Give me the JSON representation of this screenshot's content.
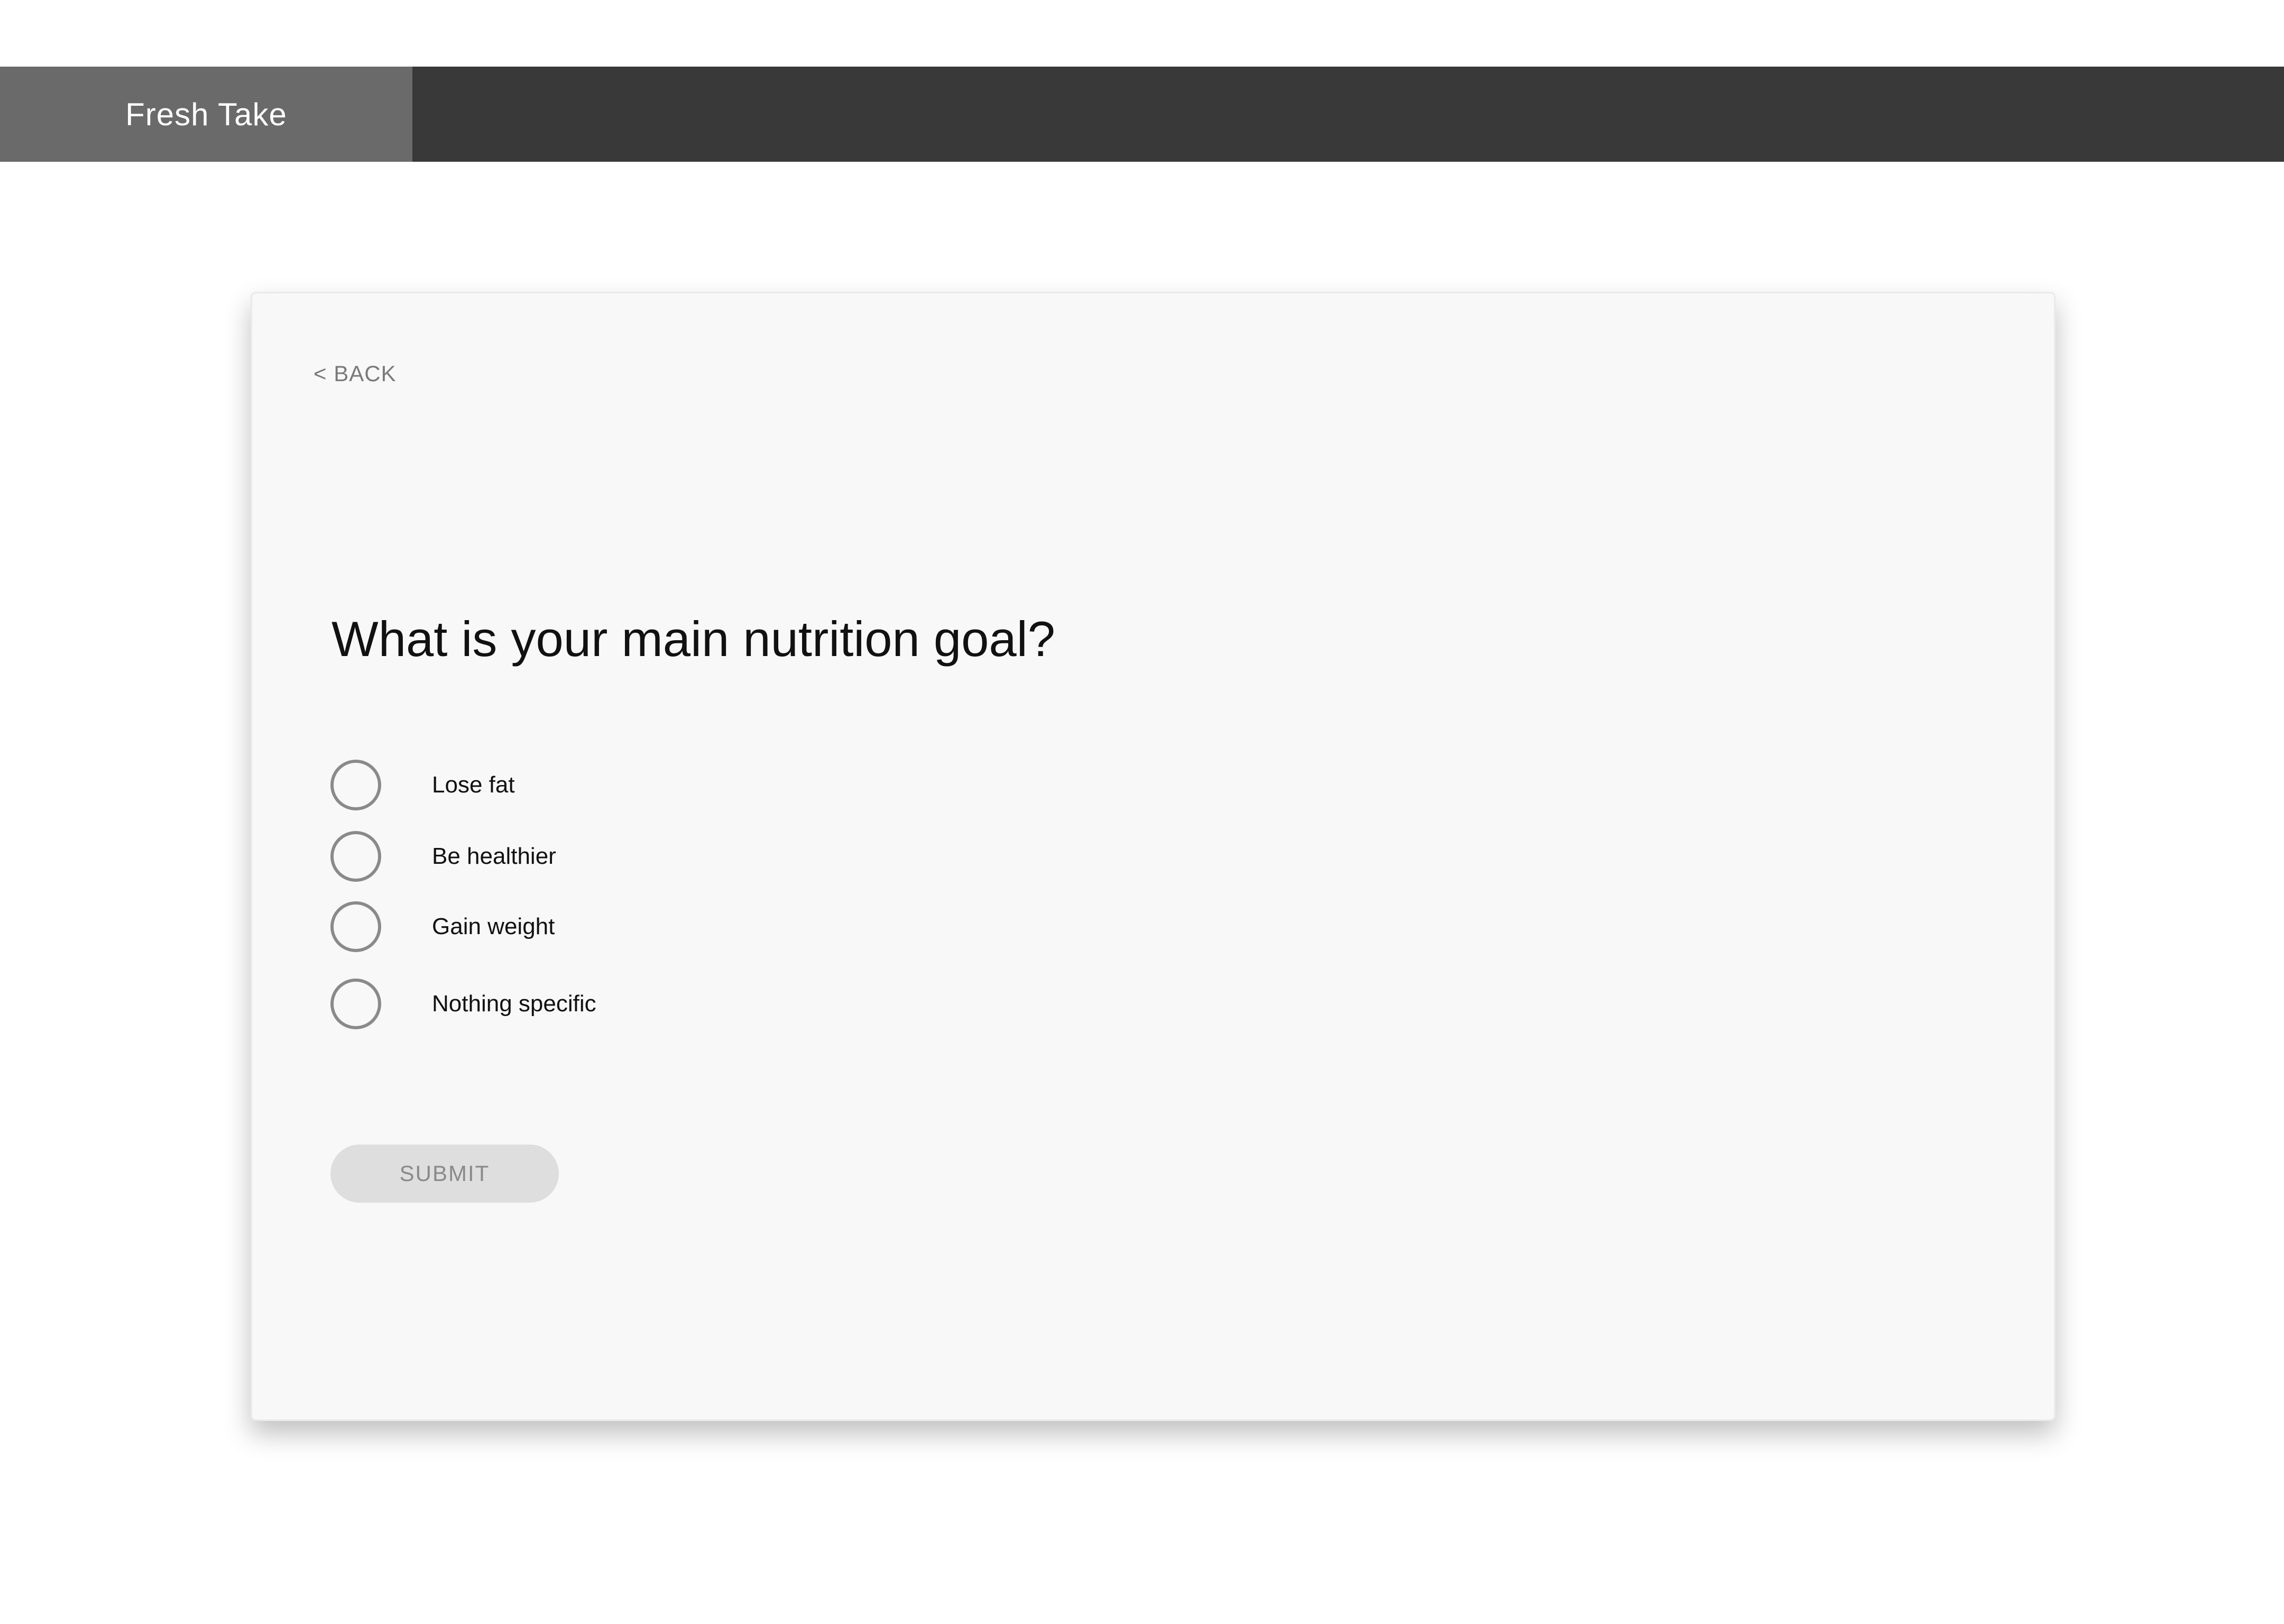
{
  "header": {
    "brand": "Fresh Take"
  },
  "card": {
    "back_label": "< BACK",
    "question": "What is your main nutrition goal?",
    "options": [
      {
        "label": "Lose fat"
      },
      {
        "label": "Be healthier"
      },
      {
        "label": "Gain weight"
      },
      {
        "label": "Nothing specific"
      }
    ],
    "submit_label": "SUBMIT"
  }
}
